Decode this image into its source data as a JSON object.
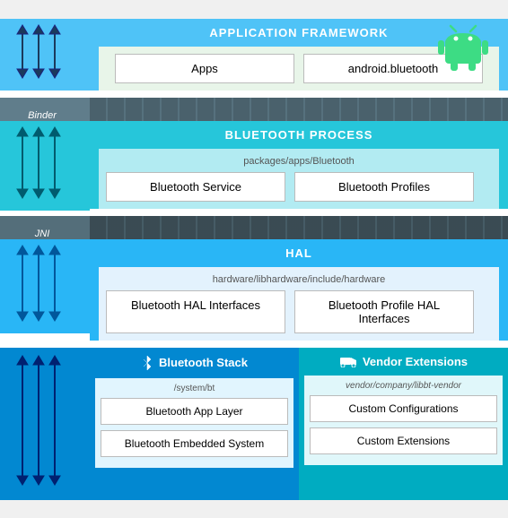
{
  "diagram": {
    "android_logo_color": "#3ddc84",
    "sections": {
      "app_framework": {
        "header": "APPLICATION FRAMEWORK",
        "background": "#4fc3f7",
        "content_bg": "#e8f5e9",
        "boxes": [
          "Apps",
          "android.bluetooth"
        ]
      },
      "binder_row": {
        "label": "Binder"
      },
      "bt_process": {
        "header": "BLUETOOTH PROCESS",
        "background": "#26c6da",
        "content_bg": "#b2ebf2",
        "subtext": "packages/apps/Bluetooth",
        "boxes": [
          "Bluetooth Service",
          "Bluetooth Profiles"
        ]
      },
      "jni_row": {
        "label": "JNI"
      },
      "hal": {
        "header": "HAL",
        "background": "#29b6f6",
        "content_bg": "#e3f2fd",
        "subtext": "hardware/libhardware/include/hardware",
        "boxes": [
          "Bluetooth HAL Interfaces",
          "Bluetooth Profile HAL Interfaces"
        ]
      },
      "bottom": {
        "bt_stack": {
          "header": "Bluetooth Stack",
          "background": "#0288d1",
          "subtext": "/system/bt",
          "boxes": [
            "Bluetooth App Layer",
            "Bluetooth Embedded System"
          ]
        },
        "vendor_ext": {
          "header": "Vendor Extensions",
          "background": "#00acc1",
          "subtext": "vendor/company/libbt-vendor",
          "boxes": [
            "Custom Configurations",
            "Custom Extensions"
          ]
        }
      }
    }
  }
}
